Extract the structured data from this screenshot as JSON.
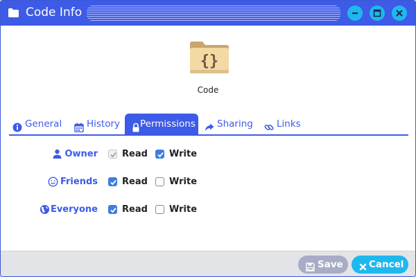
{
  "window": {
    "title": "Code Info",
    "accent_color": "#3d5be6",
    "window_button_color": "#1fb8ee"
  },
  "file": {
    "name": "Code",
    "icon": "folder-code-icon"
  },
  "tabs": [
    {
      "label": "General",
      "icon": "info-circle-icon",
      "active": false
    },
    {
      "label": "History",
      "icon": "calendar-icon",
      "active": false
    },
    {
      "label": "Permissions",
      "icon": "lock-icon",
      "active": true
    },
    {
      "label": "Sharing",
      "icon": "share-arrow-icon",
      "active": false
    },
    {
      "label": "Links",
      "icon": "link-icon",
      "active": false
    }
  ],
  "permissions": {
    "read_label": "Read",
    "write_label": "Write",
    "rows": [
      {
        "role": "Owner",
        "icon": "user-icon",
        "read": true,
        "read_disabled": true,
        "write": true
      },
      {
        "role": "Friends",
        "icon": "smile-icon",
        "read": true,
        "read_disabled": false,
        "write": false
      },
      {
        "role": "Everyone",
        "icon": "globe-icon",
        "read": true,
        "read_disabled": false,
        "write": false
      }
    ]
  },
  "footer": {
    "save_label": "Save",
    "save_icon": "floppy-disk-icon",
    "cancel_label": "Cancel",
    "cancel_icon": "x-icon"
  }
}
